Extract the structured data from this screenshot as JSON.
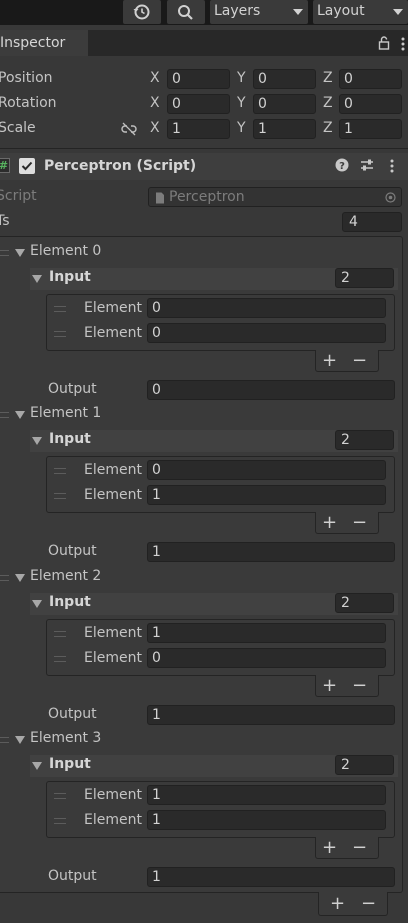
{
  "toolbar": {
    "layers_label": "Layers",
    "layout_label": "Layout"
  },
  "tab": {
    "label": "Inspector"
  },
  "transform": {
    "position": {
      "label": "Position",
      "x": "0",
      "y": "0",
      "z": "0"
    },
    "rotation": {
      "label": "Rotation",
      "x": "0",
      "y": "0",
      "z": "0"
    },
    "scale": {
      "label": "Scale",
      "x": "1",
      "y": "1",
      "z": "1"
    },
    "axis_x": "X",
    "axis_y": "Y",
    "axis_z": "Z"
  },
  "component": {
    "title": "Perceptron (Script)",
    "script_label": "Script",
    "script_value": "Perceptron",
    "ts_label": "Ts",
    "ts_count": "4",
    "input_label": "Input",
    "element_label": "Element",
    "output_label": "Output",
    "elements": [
      {
        "label": "Element 0",
        "input_count": "2",
        "values": [
          "0",
          "0"
        ],
        "output": "0"
      },
      {
        "label": "Element 1",
        "input_count": "2",
        "values": [
          "0",
          "1"
        ],
        "output": "1"
      },
      {
        "label": "Element 2",
        "input_count": "2",
        "values": [
          "1",
          "0"
        ],
        "output": "1"
      },
      {
        "label": "Element 3",
        "input_count": "2",
        "values": [
          "1",
          "1"
        ],
        "output": "1"
      }
    ],
    "plus": "+",
    "minus": "−"
  }
}
